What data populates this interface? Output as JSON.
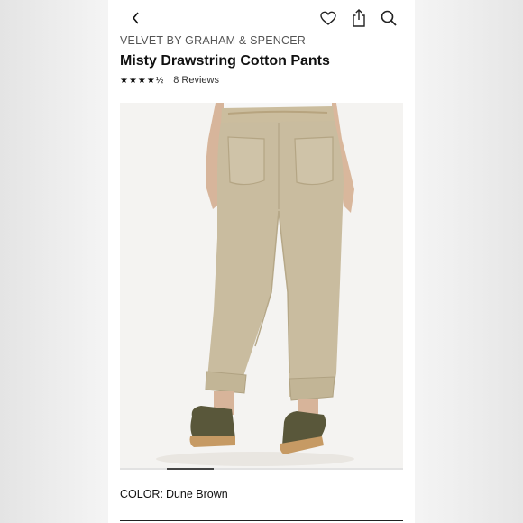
{
  "nav": {
    "back_icon": "chevron-left-icon",
    "favorite_icon": "heart-icon",
    "share_icon": "share-icon",
    "search_icon": "search-icon"
  },
  "product": {
    "brand": "VELVET BY GRAHAM & SPENCER",
    "name": "Misty Drawstring Cotton Pants",
    "rating": {
      "stars_display": "★★★★½",
      "value": 4.5,
      "out_of": 5,
      "reviews_label": "8 Reviews"
    },
    "gallery": {
      "image_subject": "khaki drawstring cotton pants worn with olive sneakers",
      "active_index": 1
    },
    "color": {
      "label": "COLOR:",
      "value": "Dune Brown"
    }
  },
  "colors": {
    "pants": "#c9bc9f",
    "shoe": "#59573a",
    "sole": "#c69a64",
    "indicator_active": "#444444",
    "indicator_track": "#e2e2e2"
  }
}
